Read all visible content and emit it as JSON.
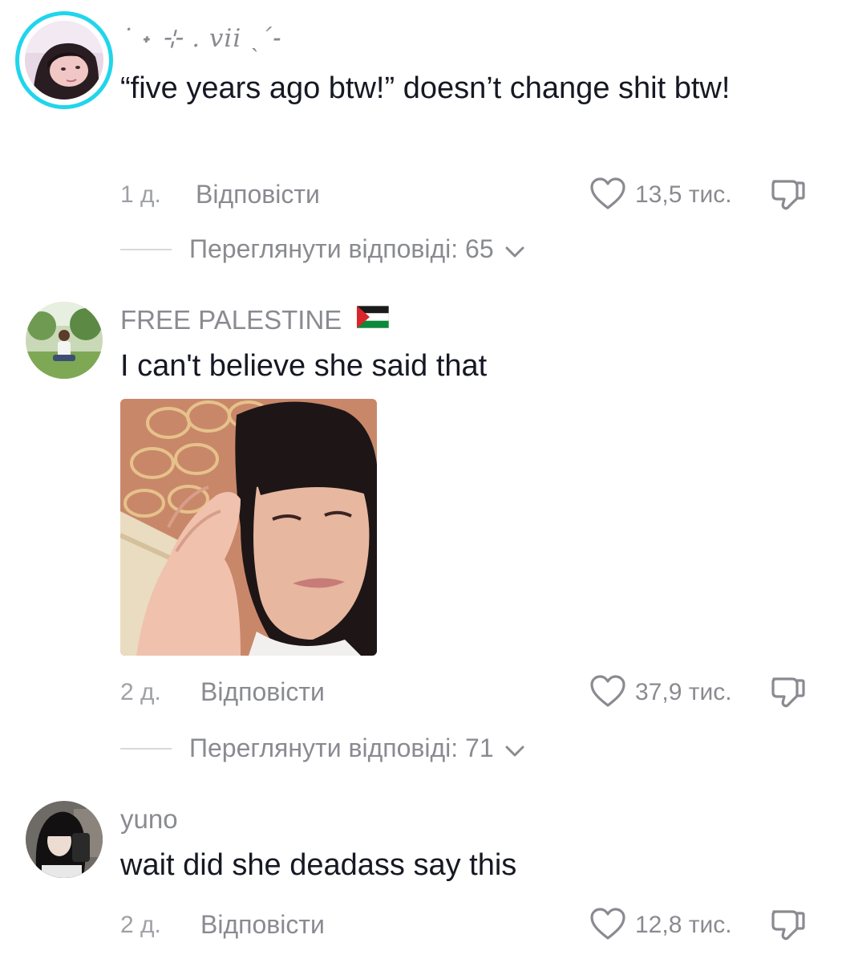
{
  "comments": [
    {
      "username": "˙ ˖ ⊹ . vii ˎˊ˗",
      "text": "“five years ago btw!” doesn’t change shit btw!",
      "time": "1 д.",
      "reply_label": "Відповісти",
      "likes": "13,5 тис.",
      "view_replies": "Переглянути відповіді: 65",
      "icons": [
        "heart-icon",
        "thumbs-down-icon",
        "chevron-down-icon"
      ]
    },
    {
      "username": "FREE PALESTINE",
      "username_emoji": "palestine-flag",
      "text": "I can't believe she said that",
      "has_image": true,
      "time": "2 д.",
      "reply_label": "Відповісти",
      "likes": "37,9 тис.",
      "view_replies": "Переглянути відповіді: 71",
      "icons": [
        "heart-icon",
        "thumbs-down-icon",
        "chevron-down-icon"
      ]
    },
    {
      "username": "yuno",
      "text": "wait did she deadass say this",
      "time": "2 д.",
      "reply_label": "Відповісти",
      "likes": "12,8 тис.",
      "icons": [
        "heart-icon",
        "thumbs-down-icon"
      ]
    }
  ],
  "colors": {
    "story_ring": "#20d5ec",
    "text_primary": "#161823",
    "text_secondary": "#8a8b91"
  }
}
